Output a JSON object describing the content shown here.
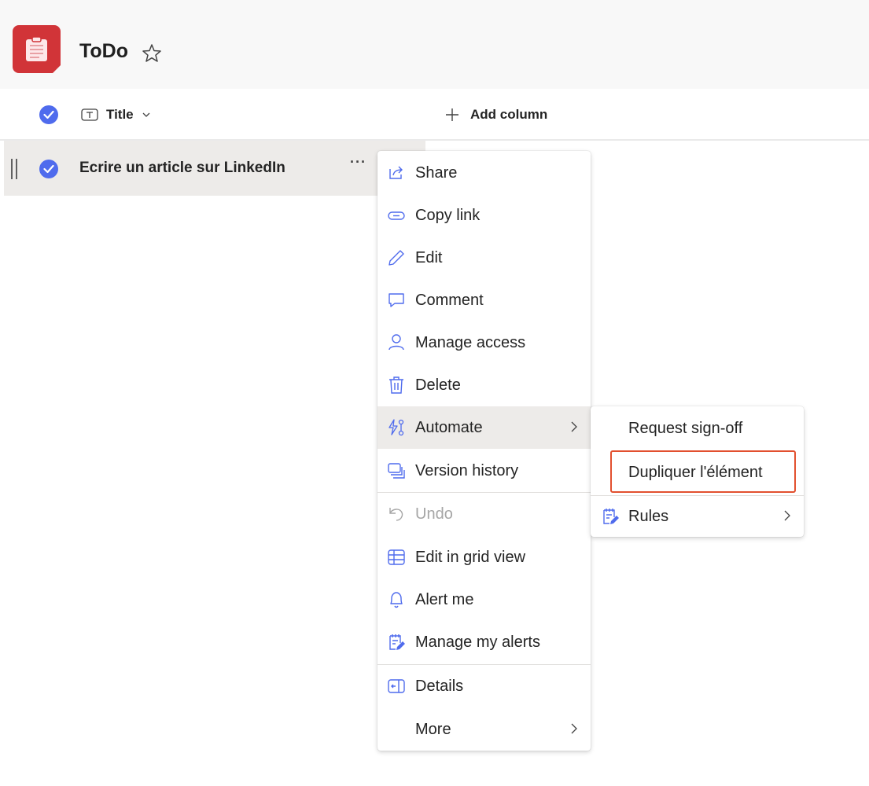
{
  "header": {
    "title": "ToDo"
  },
  "columns": {
    "title_label": "Title",
    "add_column_label": "Add column"
  },
  "rows": [
    {
      "title": "Ecrire un article sur LinkedIn",
      "more": "···"
    }
  ],
  "context_menu": {
    "share": "Share",
    "copy_link": "Copy link",
    "edit": "Edit",
    "comment": "Comment",
    "manage_access": "Manage access",
    "delete": "Delete",
    "automate": "Automate",
    "version_history": "Version history",
    "undo": "Undo",
    "edit_grid": "Edit in grid view",
    "alert_me": "Alert me",
    "manage_alerts": "Manage my alerts",
    "details": "Details",
    "more": "More"
  },
  "automate_submenu": {
    "request_signoff": "Request sign-off",
    "duplicate": "Dupliquer l'élément",
    "rules": "Rules"
  },
  "colors": {
    "accent": "#4f6bed",
    "app_icon": "#d13438",
    "highlight": "#e2502f"
  }
}
